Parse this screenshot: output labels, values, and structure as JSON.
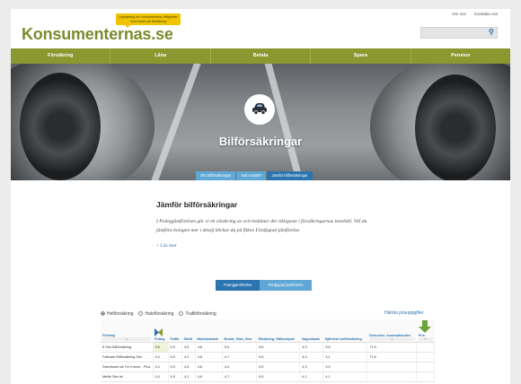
{
  "header": {
    "logo": "Konsumenternas.se",
    "tagline": "Upplysning om konsumentens rättigheter inom bank och försäkring",
    "top_links": [
      "Om oss",
      "Kontakta oss"
    ]
  },
  "nav": [
    "Försäkring",
    "Låna",
    "Betala",
    "Spara",
    "Pension"
  ],
  "hero": {
    "title": "Bilförsäkringar",
    "tabs": [
      {
        "label": "Om bilförsäkringar",
        "active": false
      },
      {
        "label": "Vad ersätts?",
        "active": false
      },
      {
        "label": "Jämför bilförsäkringar",
        "active": true
      }
    ]
  },
  "main": {
    "heading": "Jämför bilförsäkringar",
    "intro": "I Poängjämförelsen gör vi en värdering av och bedömer det viktigaste i försäkringarnas innehåll. Vill du jämföra bolagen mer i detalj klickar du på fliken Fördjupad jämförelse.",
    "read_more": "+ Läs mer",
    "toggle": [
      {
        "label": "Poängjämförelse",
        "active": true
      },
      {
        "label": "Fördjupad jämförelse",
        "active": false
      }
    ]
  },
  "filters": {
    "options": [
      {
        "label": "Helförsäkring",
        "selected": true
      },
      {
        "label": "Halvförsäkring",
        "selected": false
      },
      {
        "label": "Trafikförsäkring",
        "selected": false
      }
    ],
    "download": "Hämta prisuppgifter"
  },
  "table": {
    "headers": [
      "Företag",
      "Poäng",
      "Trafik",
      "Stöld",
      "Maskinskada",
      "Brand, Glas, Stor",
      "Räddning, Rättsskydd",
      "Vagnskada",
      "Självrisk bolförsäkring",
      "Genomsn. kostnadsindex",
      "Pris"
    ],
    "rows": [
      {
        "company": "If Stor Bilförsäkring",
        "cells": [
          "4,5",
          "5,5",
          "4,5",
          "4,8",
          "5,5",
          "5,6",
          "4,9",
          "5,5",
          "71,9",
          ""
        ]
      },
      {
        "company": "Folksam Bilförsäkring Stor",
        "cells": [
          "4,4",
          "5,5",
          "4,2",
          "4,8",
          "4,7",
          "5,5",
          "4,4",
          "4,1",
          "71,6",
          ""
        ]
      },
      {
        "company": "Swedbank via Tre Kronor - Plus",
        "cells": [
          "4,4",
          "5,5",
          "4,5",
          "4,6",
          "4,4",
          "5,5",
          "4,3",
          "3,9",
          "",
          ""
        ]
      },
      {
        "company": "Mellie Stor bil",
        "cells": [
          "4,4",
          "5,5",
          "4,1",
          "4,6",
          "4,7",
          "5,5",
          "4,2",
          "4,1",
          "",
          ""
        ]
      }
    ]
  },
  "colors": {
    "brand": "#8b972f",
    "accent_blue": "#2b74b0",
    "tab_blue": "#5fa8d6",
    "tagline_yellow": "#f0c400"
  }
}
